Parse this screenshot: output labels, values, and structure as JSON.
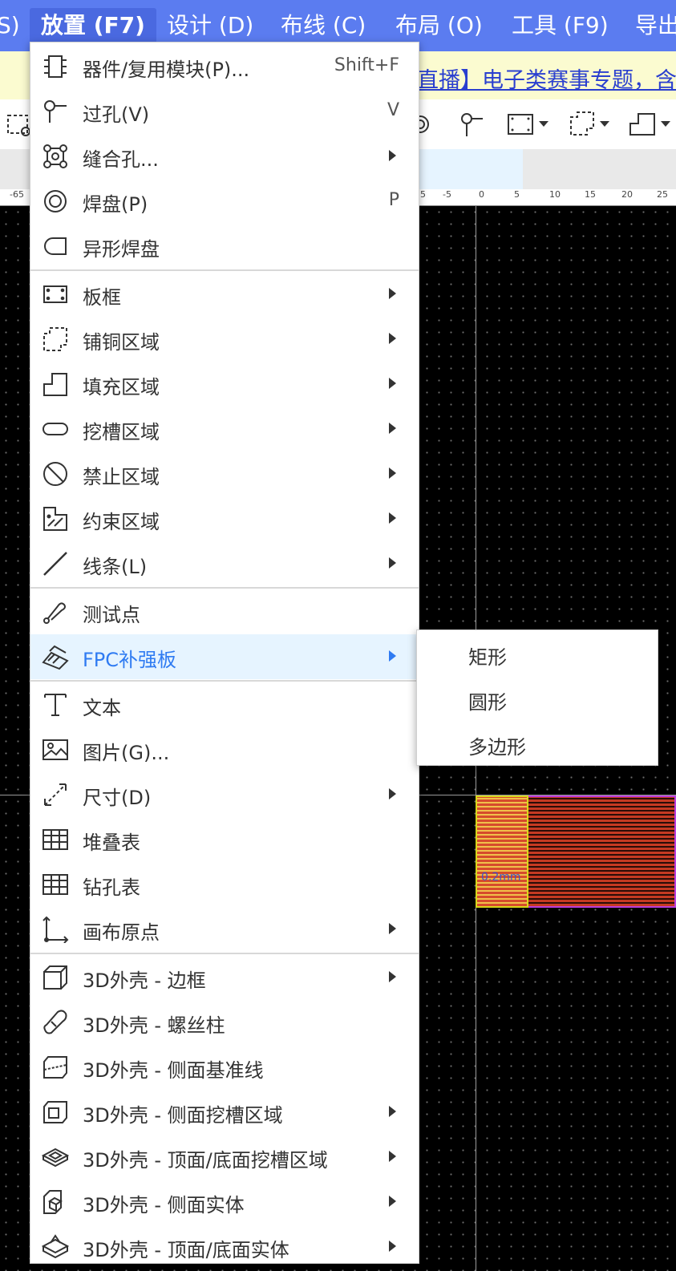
{
  "menubar": {
    "items": [
      "S)",
      "放置 (F7)",
      "设计 (D)",
      "布线 (C)",
      "布局 (O)",
      "工具 (F9)",
      "导出"
    ]
  },
  "notice": {
    "text": "直播】电子类赛事专题，含全"
  },
  "ruler": {
    "labels": [
      "-65",
      "5",
      "-5",
      "0",
      "5",
      "10",
      "15",
      "20",
      "25"
    ]
  },
  "canvas": {
    "fpc_label": "0.2mm"
  },
  "menu": {
    "items": [
      {
        "label": "器件/复用模块(P)...",
        "shortcut": "Shift+F",
        "icon": "component-icon"
      },
      {
        "label": "过孔(V)",
        "shortcut": "V",
        "icon": "via-icon"
      },
      {
        "label": "缝合孔...",
        "icon": "stitch-via-icon",
        "submenu": true
      },
      {
        "label": "焊盘(P)",
        "shortcut": "P",
        "icon": "pad-icon"
      },
      {
        "label": "异形焊盘",
        "icon": "custom-pad-icon"
      },
      {
        "label": "板框",
        "icon": "board-outline-icon",
        "submenu": true
      },
      {
        "label": "铺铜区域",
        "icon": "copper-area-icon",
        "submenu": true
      },
      {
        "label": "填充区域",
        "icon": "fill-area-icon",
        "submenu": true
      },
      {
        "label": "挖槽区域",
        "icon": "slot-area-icon",
        "submenu": true
      },
      {
        "label": "禁止区域",
        "icon": "forbidden-area-icon",
        "submenu": true
      },
      {
        "label": "约束区域",
        "icon": "constraint-area-icon",
        "submenu": true
      },
      {
        "label": "线条(L)",
        "icon": "line-icon",
        "submenu": true
      },
      {
        "label": "测试点",
        "icon": "test-point-icon"
      },
      {
        "label": "FPC补强板",
        "icon": "fpc-stiffener-icon",
        "submenu": true,
        "highlight": true
      },
      {
        "label": "文本",
        "icon": "text-icon"
      },
      {
        "label": "图片(G)...",
        "icon": "image-icon"
      },
      {
        "label": "尺寸(D)",
        "icon": "dimension-icon",
        "submenu": true
      },
      {
        "label": "堆叠表",
        "icon": "stackup-table-icon"
      },
      {
        "label": "钻孔表",
        "icon": "drill-table-icon"
      },
      {
        "label": "画布原点",
        "icon": "canvas-origin-icon",
        "submenu": true
      },
      {
        "label": "3D外壳 - 边框",
        "icon": "enclosure-frame-icon",
        "submenu": true
      },
      {
        "label": "3D外壳 - 螺丝柱",
        "icon": "screw-post-icon"
      },
      {
        "label": "3D外壳 - 侧面基准线",
        "icon": "side-reference-line-icon"
      },
      {
        "label": "3D外壳 - 侧面挖槽区域",
        "icon": "side-slot-icon",
        "submenu": true
      },
      {
        "label": "3D外壳 - 顶面/底面挖槽区域",
        "icon": "top-bottom-slot-icon",
        "submenu": true
      },
      {
        "label": "3D外壳 - 侧面实体",
        "icon": "side-solid-icon",
        "submenu": true
      },
      {
        "label": "3D外壳 - 顶面/底面实体",
        "icon": "top-bottom-solid-icon",
        "submenu": true
      }
    ]
  },
  "submenu": {
    "items": [
      "矩形",
      "圆形",
      "多边形"
    ]
  }
}
